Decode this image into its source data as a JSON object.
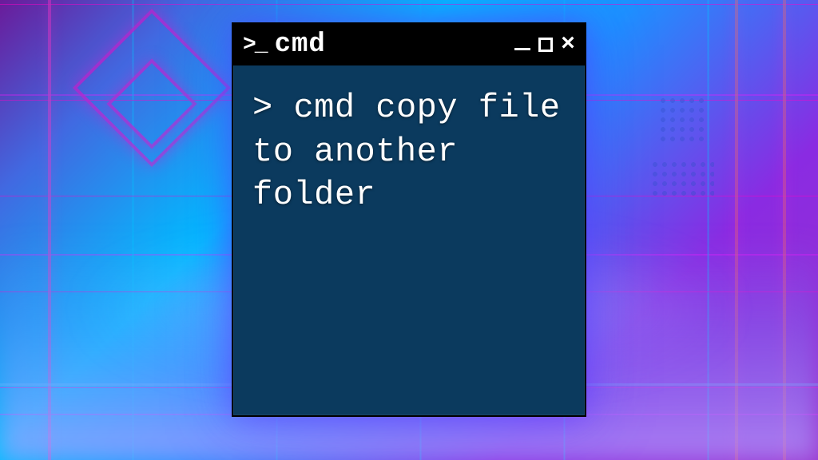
{
  "window": {
    "title": "cmd",
    "icon_label": ">_"
  },
  "terminal": {
    "prompt": ">",
    "command": "cmd copy file to another folder"
  },
  "colors": {
    "terminal_bg": "#0b3a5e",
    "titlebar_bg": "#000000",
    "text": "#ffffff"
  }
}
